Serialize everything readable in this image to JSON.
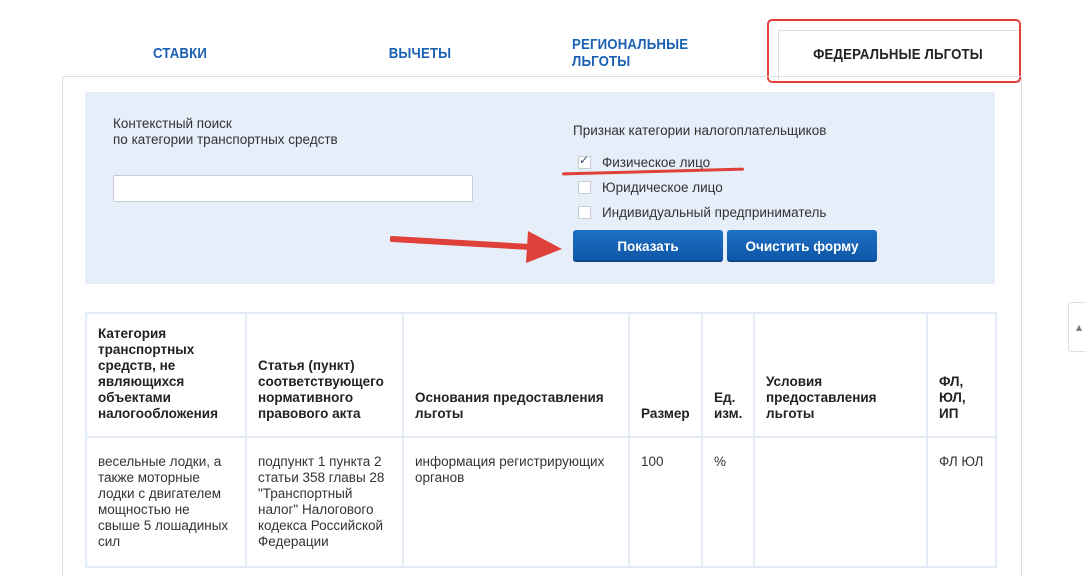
{
  "tabs": {
    "rates": "СТАВКИ",
    "deductions": "ВЫЧЕТЫ",
    "regional": "РЕГИОНАЛЬНЫЕ ЛЬГОТЫ",
    "federal": "ФЕДЕРАЛЬНЫЕ ЛЬГОТЫ",
    "active": "federal"
  },
  "search": {
    "label_line1": "Контекстный поиск",
    "label_line2": "по категории транспортных средств",
    "value": "",
    "placeholder": ""
  },
  "taxpayer": {
    "title": "Признак категории налогоплательщиков",
    "options": [
      {
        "label": "Физическое лицо",
        "checked": true
      },
      {
        "label": "Юридическое лицо",
        "checked": false
      },
      {
        "label": "Индивидуальный предприниматель",
        "checked": false
      }
    ]
  },
  "buttons": {
    "show": "Показать",
    "clear": "Очистить форму"
  },
  "table": {
    "headers": [
      "Категория транспортных средств, не являющихся объектами налогообложения",
      "Статья (пункт) соответствующего нормативного правового акта",
      "Основания предоставления льготы",
      "Размер",
      "Ед. изм.",
      "Условия предоставления льготы",
      "ФЛ, ЮЛ, ИП"
    ],
    "rows": [
      [
        "весельные лодки, а также моторные лодки с двигателем мощностью не свыше 5 лошадиных сил",
        "подпункт 1 пункта 2 статьи 358 главы 28 \"Транспортный налог\" Налогового кодекса Российской Федерации",
        "информация регистрирующих органов",
        "100",
        "%",
        "",
        "ФЛ ЮЛ"
      ]
    ]
  },
  "scroll_icon": "chevron-up-icon",
  "colors": {
    "accent_blue": "#1a61b3",
    "button_blue": "#0e56a6",
    "form_bg": "#e6eef9",
    "annotation_red": "#e0403a"
  }
}
